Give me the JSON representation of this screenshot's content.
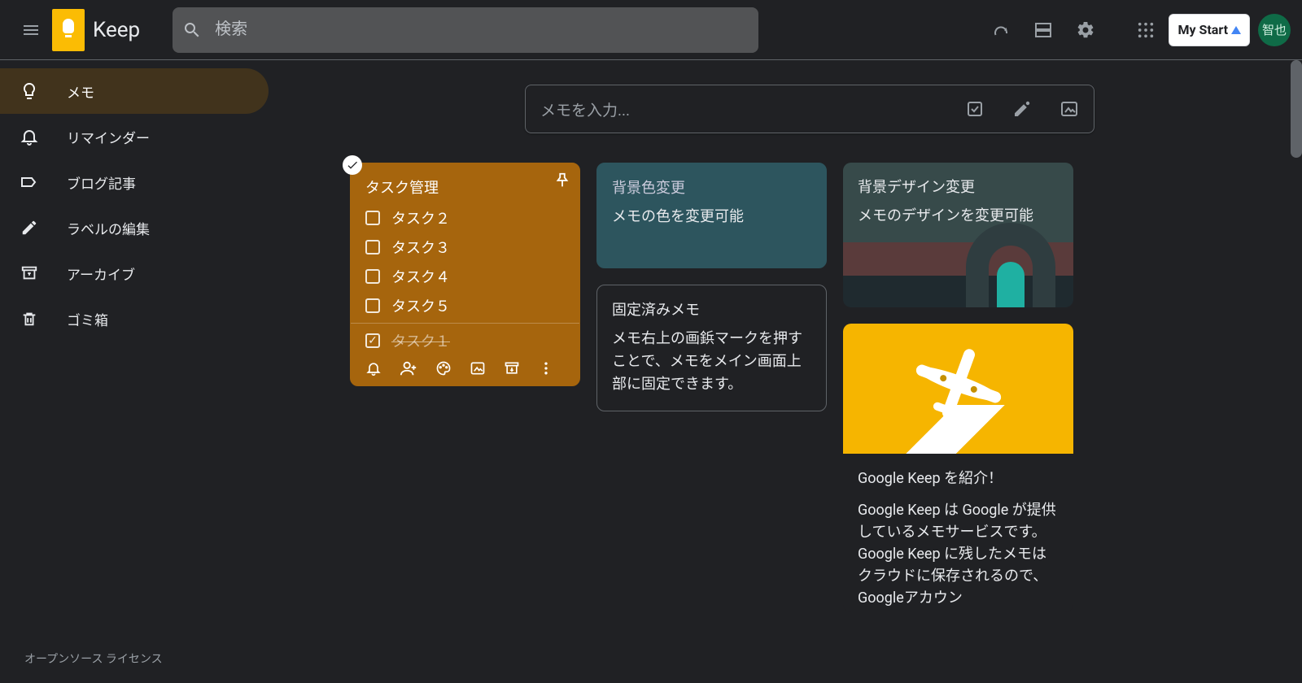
{
  "header": {
    "app_title": "Keep",
    "search_placeholder": "検索",
    "mystart_label": "My Start",
    "avatar_label": "智也"
  },
  "sidebar": {
    "items": [
      {
        "label": "メモ"
      },
      {
        "label": "リマインダー"
      },
      {
        "label": "ブログ記事"
      },
      {
        "label": "ラベルの編集"
      },
      {
        "label": "アーカイブ"
      },
      {
        "label": "ゴミ箱"
      }
    ],
    "footer": "オープンソース ライセンス"
  },
  "take_note": {
    "placeholder": "メモを入力..."
  },
  "cards": {
    "tasks": {
      "title": "タスク管理",
      "items": [
        "タスク２",
        "タスク３",
        "タスク４",
        "タスク５"
      ],
      "done": "タスク１"
    },
    "green": {
      "title": "背景色変更",
      "body": "メモの色を変更可能"
    },
    "pinned": {
      "title": "固定済みメモ",
      "body": "メモ右上の画鋲マークを押すことで、メモをメイン画面上部に固定できます。"
    },
    "designbg": {
      "title": "背景デザイン変更",
      "body": "メモのデザインを変更可能"
    },
    "intro": {
      "title": "Google Keep を紹介！",
      "p1": "Google Keep は Google が提供しているメモサービスです。",
      "p2": "Google Keep に残したメモはクラウドに保存されるので、Googleアカウン"
    }
  }
}
